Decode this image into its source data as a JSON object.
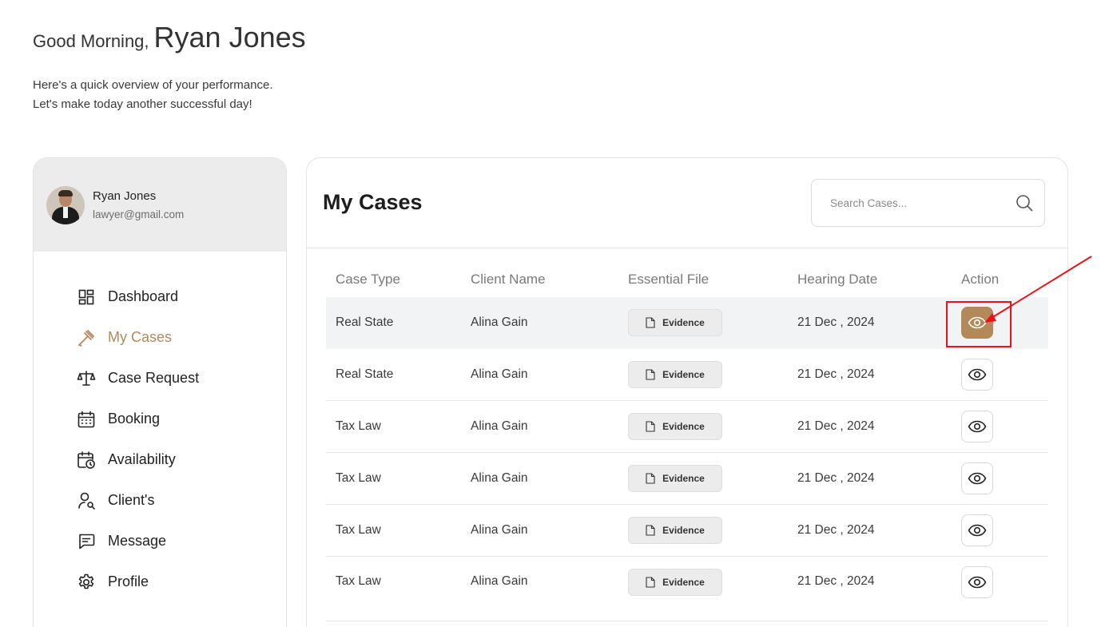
{
  "greeting": {
    "hello": "Good Morning,",
    "name": "Ryan Jones",
    "line1": "Here's a quick overview of your performance.",
    "line2": "Let's make today another successful day!"
  },
  "profile": {
    "name": "Ryan Jones",
    "email": "lawyer@gmail.com"
  },
  "nav": {
    "items": [
      {
        "label": "Dashboard",
        "icon": "dashboard-icon"
      },
      {
        "label": "My Cases",
        "icon": "gavel-icon",
        "active": true
      },
      {
        "label": "Case Request",
        "icon": "scale-icon"
      },
      {
        "label": "Booking",
        "icon": "calendar-icon"
      },
      {
        "label": "Availability",
        "icon": "calendar-clock-icon"
      },
      {
        "label": "Client's",
        "icon": "user-search-icon"
      },
      {
        "label": "Message",
        "icon": "message-icon"
      },
      {
        "label": "Profile",
        "icon": "gear-icon"
      }
    ]
  },
  "main": {
    "title": "My Cases",
    "search_placeholder": "Search Cases...",
    "columns": [
      "Case Type",
      "Client Name",
      "Essential File",
      "Hearing Date",
      "Action"
    ],
    "rows": [
      {
        "case_type": "Real State",
        "client": "Alina Gain",
        "file": "Evidence",
        "date": "21 Dec , 2024"
      },
      {
        "case_type": "Real State",
        "client": "Alina Gain",
        "file": "Evidence",
        "date": "21 Dec , 2024"
      },
      {
        "case_type": "Tax Law",
        "client": "Alina Gain",
        "file": "Evidence",
        "date": "21 Dec , 2024"
      },
      {
        "case_type": "Tax Law",
        "client": "Alina Gain",
        "file": "Evidence",
        "date": "21 Dec , 2024"
      },
      {
        "case_type": "Tax Law",
        "client": "Alina Gain",
        "file": "Evidence",
        "date": "21 Dec , 2024"
      },
      {
        "case_type": "Tax Law",
        "client": "Alina Gain",
        "file": "Evidence",
        "date": "21 Dec , 2024"
      }
    ]
  },
  "colors": {
    "accent": "#b4895a",
    "highlight_row": "#f2f3f5",
    "annotation": "#e8141a"
  }
}
